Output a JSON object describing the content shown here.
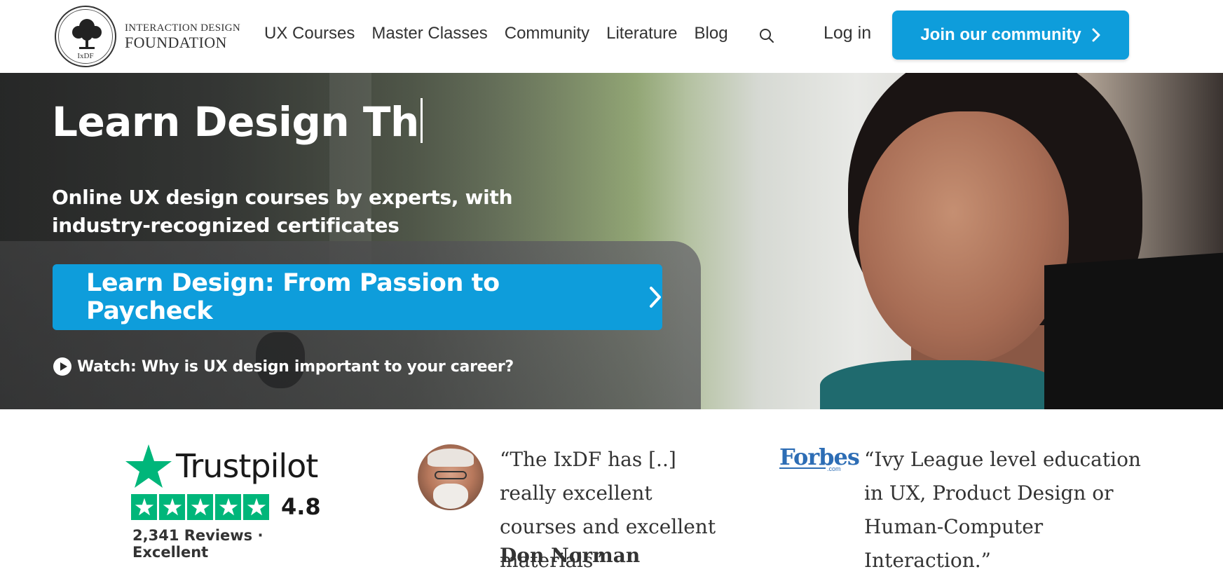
{
  "logo": {
    "line1": "INTERACTION DESIGN",
    "line2": "FOUNDATION",
    "badge": "IxDF",
    "icon": "tree-logo-icon"
  },
  "nav": {
    "items": [
      "UX Courses",
      "Master Classes",
      "Community",
      "Literature",
      "Blog"
    ],
    "search_icon": "search-icon",
    "login": "Log in",
    "join": "Join our community"
  },
  "hero": {
    "title_typed": "Learn Design Th",
    "subtitle": "Online UX design courses by experts, with industry-recognized certificates",
    "cta": "Learn Design: From Passion to Paycheck",
    "watch": "Watch: Why is UX design important to your career?"
  },
  "trustpilot": {
    "brand": "Trustpilot",
    "rating": "4.8",
    "stars": 5,
    "reviews": "2,341 Reviews · Excellent"
  },
  "testimonial1": {
    "quote": "“The IxDF has [..] really excellent courses and excellent materials”",
    "author": "Don Norman"
  },
  "testimonial2": {
    "brand": "Forbes",
    "brand_suffix": ".com",
    "quote": "“Ivy League level education in UX, Product Design or Human-Computer Interaction.”"
  },
  "colors": {
    "accent": "#0e9ddb",
    "trustpilot_green": "#00b67a",
    "forbes_blue": "#2d6db5"
  }
}
